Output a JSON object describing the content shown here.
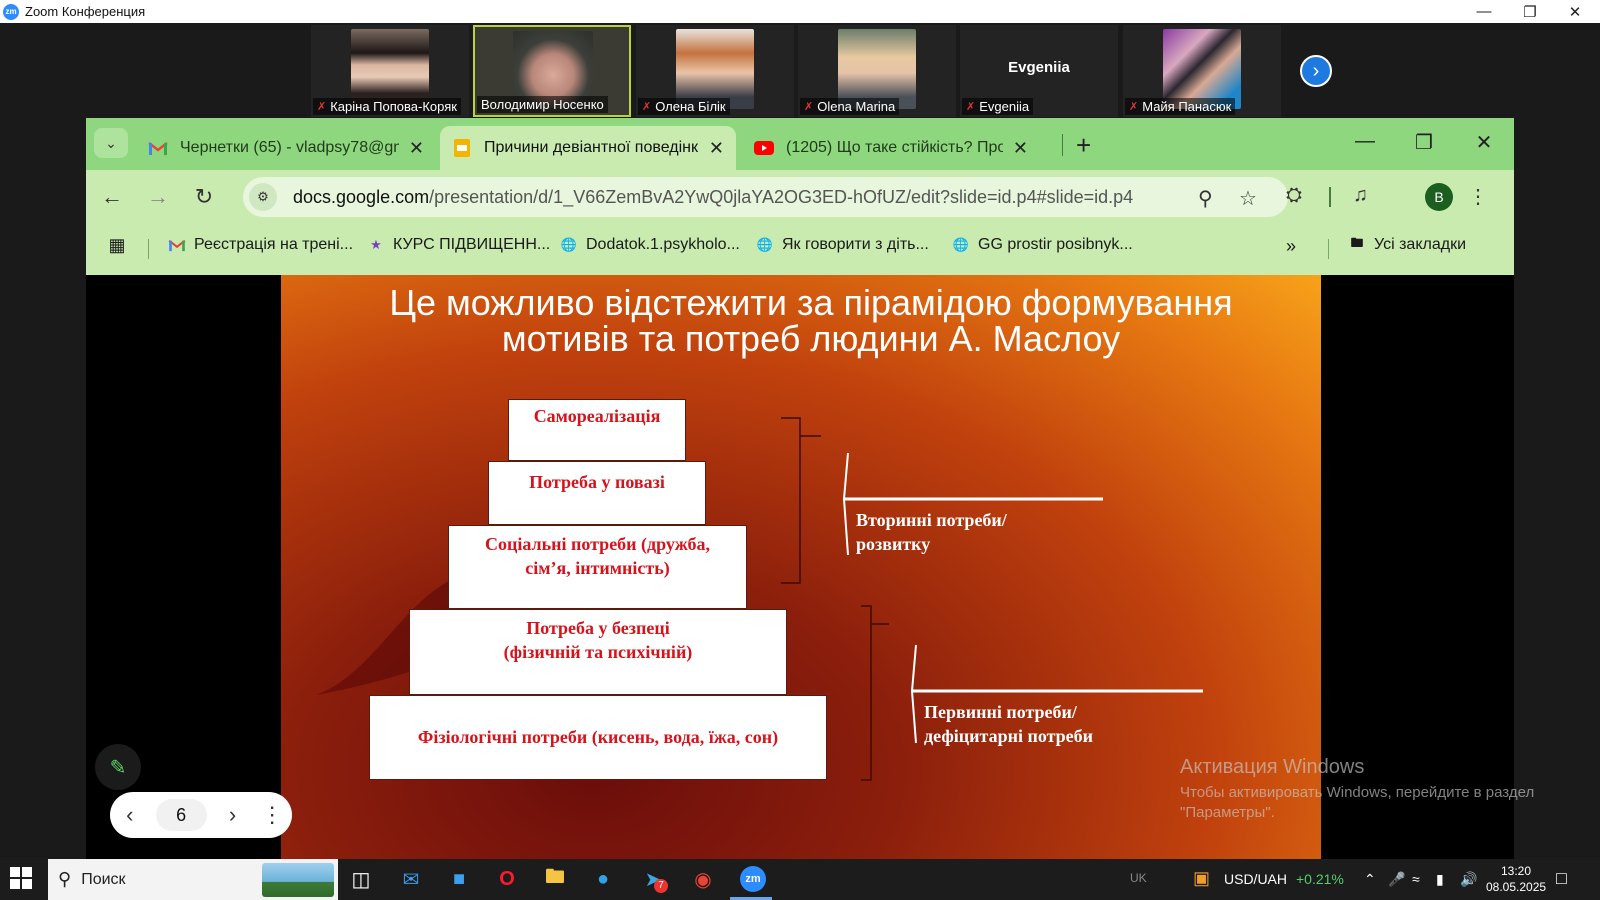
{
  "zoom": {
    "title": "Zoom Конференция",
    "participants": [
      {
        "name": "Каріна Попова-Коряк",
        "muted": true
      },
      {
        "name": "Володимир Носенко",
        "muted": false,
        "active_speaker": true
      },
      {
        "name": "Олена Білік",
        "muted": true
      },
      {
        "name": "Olena Marina",
        "muted": true
      },
      {
        "name": "Evgeniia",
        "muted": true,
        "video_label": "Evgeniia"
      },
      {
        "name": "Майя Панасюк",
        "muted": true
      }
    ]
  },
  "browser": {
    "tabs": [
      {
        "title": "Чернетки (65) - vladpsy78@gm",
        "favicon": "gmail-icon",
        "active": false
      },
      {
        "title": "Причини девіантної поведінк",
        "favicon": "google-slides-icon",
        "active": true
      },
      {
        "title": "(1205) Що таке стійкість? Про",
        "favicon": "youtube-icon",
        "active": false
      }
    ],
    "url_host": "docs.google.com",
    "url_path": "/presentation/d/1_V66ZemBvA2YwQ0jlaYA2OG3ED-hOfUZ/edit?slide=id.p4#slide=id.p4",
    "profile_initial": "В",
    "bookmarks": [
      {
        "label": "Реєстрація на трені...",
        "icon": "gmail-icon"
      },
      {
        "label": "КУРС ПІДВИЩЕНН...",
        "icon": "star-icon"
      },
      {
        "label": "Dodatok.1.psykholo...",
        "icon": "globe-icon"
      },
      {
        "label": "Як говорити з діть...",
        "icon": "globe-icon"
      },
      {
        "label": "GG prostir posibnyk...",
        "icon": "globe-icon"
      }
    ],
    "all_bookmarks_label": "Усі закладки"
  },
  "slide": {
    "title": "Це можливо відстежити за пірамідою формування мотивів та потреб людини А. Маслоу",
    "levels": [
      {
        "line1": "Самореалізація",
        "line2": ""
      },
      {
        "line1": "Потреба у повазі",
        "line2": ""
      },
      {
        "line1": "Соціальні потреби (дружба,",
        "line2": "сім’я, інтимність)"
      },
      {
        "line1": "Потреба у безпеці",
        "line2": "(фізичній та психічній)"
      },
      {
        "line1": "Фізіологічні потреби (кисень, вода, їжа, сон)",
        "line2": ""
      }
    ],
    "secondary_label": {
      "line1": "Вторинні потреби/",
      "line2": "розвитку"
    },
    "primary_label": {
      "line1": "Первинні потреби/",
      "line2": "дефіцитарні потреби"
    },
    "current_slide": "6"
  },
  "activation": {
    "title": "Активация Windows",
    "subtitle": "Чтобы активировать Windows, перейдите в раздел \"Параметры\"."
  },
  "taskbar": {
    "search_placeholder": "Поиск",
    "currency_label": "USD/UAH",
    "currency_change": "+0.21%",
    "language": "UK",
    "time": "13:20",
    "date": "08.05.2025",
    "mail_badge": "7"
  },
  "colors": {
    "tab_bar": "#8fd77f",
    "toolbar": "#c9ebb0",
    "pyramid_text": "#d6131c",
    "zoom_active_border": "#b9d43a",
    "currency_up": "#4fd06a"
  }
}
